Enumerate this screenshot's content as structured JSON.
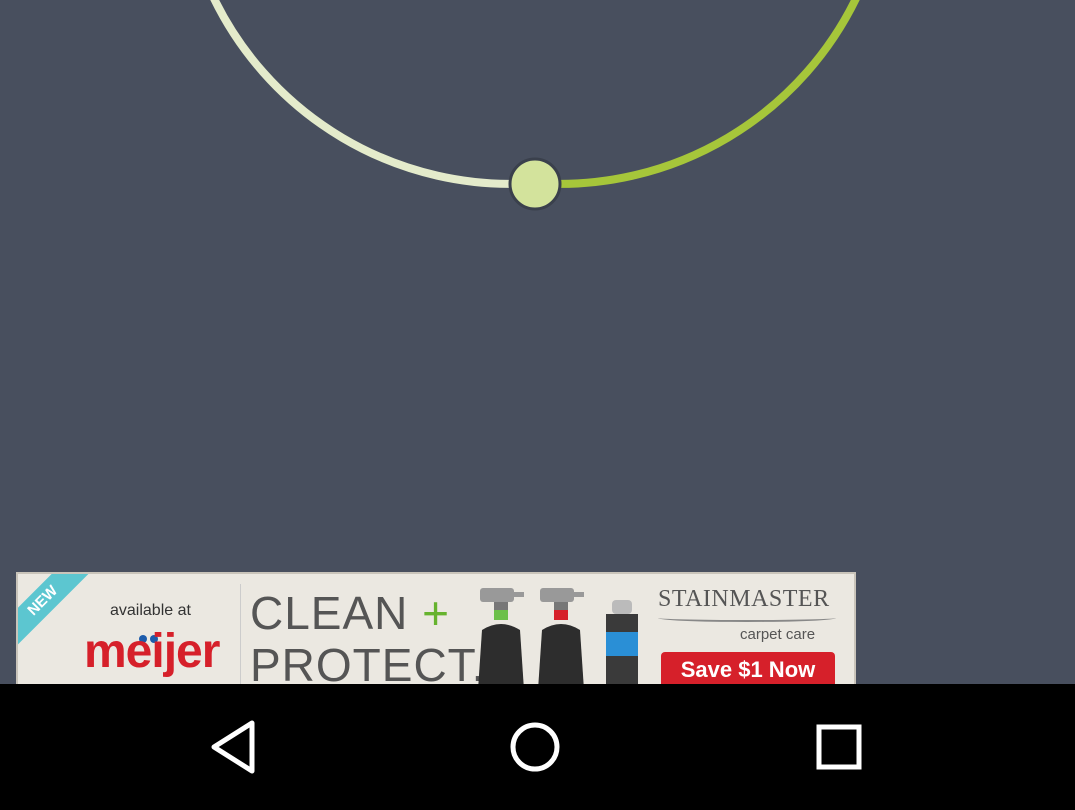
{
  "dial": {
    "track_color_left": "#e4ebcb",
    "track_color_right": "#a6c63a",
    "thumb_color": "#d3e39c",
    "background": "#484f5e"
  },
  "ad": {
    "ribbon": "NEW",
    "available_text": "available at",
    "store": "meijer",
    "headline_line1": "CLEAN",
    "headline_plus": "+",
    "headline_line2": "PROTECT.",
    "brand": "STAINMASTER",
    "brand_sub": "carpet care",
    "cta": "Save $1 Now"
  },
  "navbar": {
    "back": "back-icon",
    "home": "home-icon",
    "recents": "recents-icon"
  }
}
